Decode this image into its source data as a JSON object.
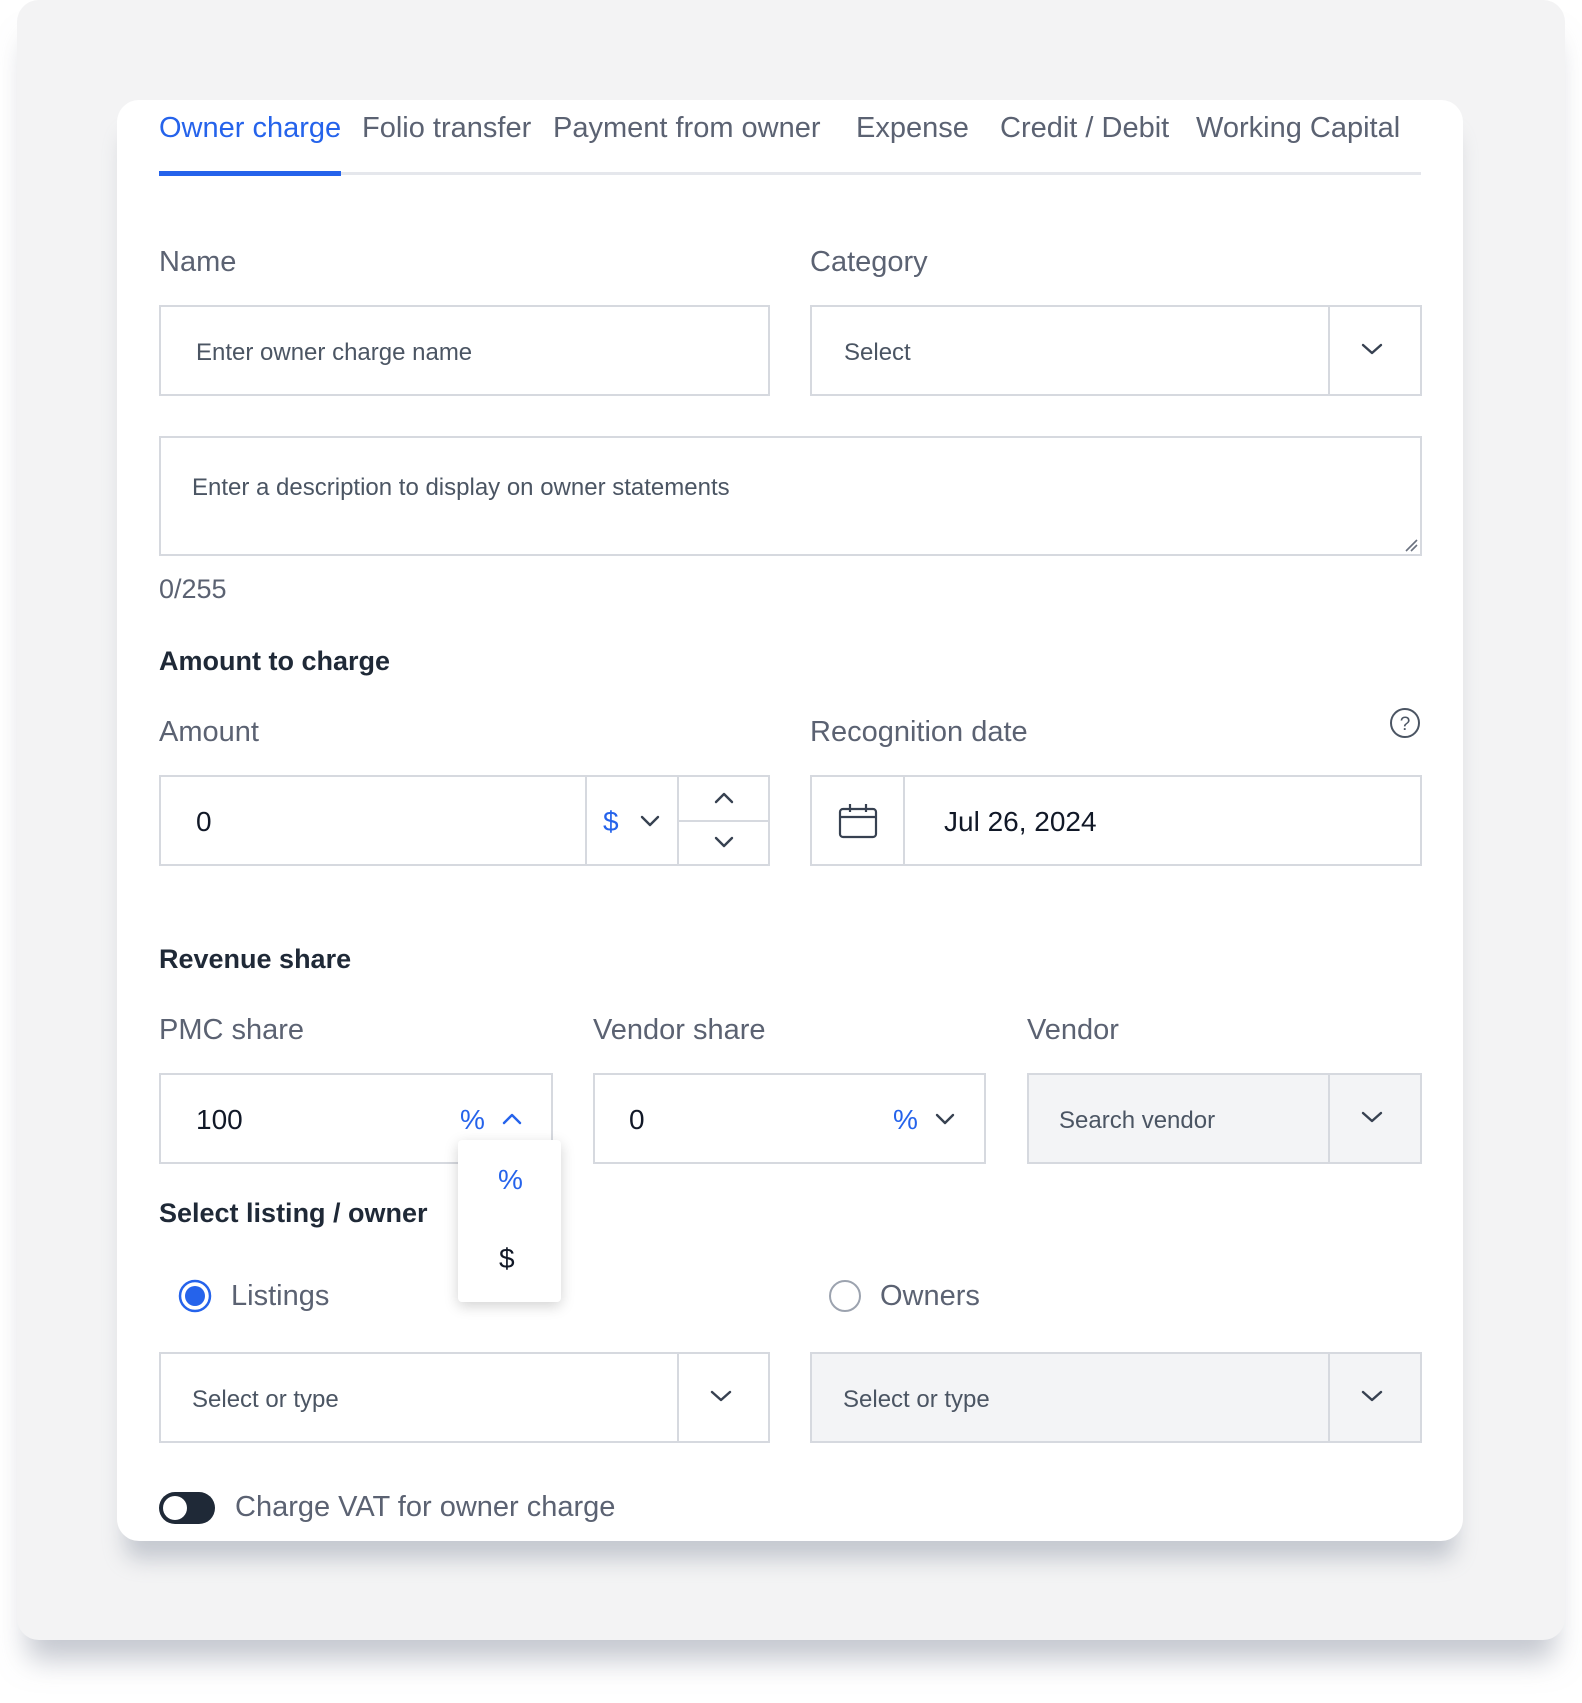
{
  "tabs": [
    {
      "label": "Owner charge",
      "active": true
    },
    {
      "label": "Folio transfer",
      "active": false
    },
    {
      "label": "Payment from owner",
      "active": false
    },
    {
      "label": "Expense",
      "active": false
    },
    {
      "label": "Credit / Debit",
      "active": false
    },
    {
      "label": "Working Capital",
      "active": false
    }
  ],
  "name": {
    "label": "Name",
    "placeholder": "Enter owner charge name"
  },
  "category": {
    "label": "Category",
    "placeholder": "Select"
  },
  "description": {
    "placeholder": "Enter a description to display on owner statements",
    "counter": "0/255"
  },
  "amount_section": {
    "title": "Amount to charge",
    "amount_label": "Amount",
    "amount_value": "0",
    "currency_symbol": "$",
    "recognition_label": "Recognition date",
    "recognition_date": "Jul 26, 2024"
  },
  "revenue_share": {
    "title": "Revenue share",
    "pmc_label": "PMC share",
    "pmc_value": "100",
    "pmc_unit": "%",
    "vendor_share_label": "Vendor share",
    "vendor_share_value": "0",
    "vendor_share_unit": "%",
    "vendor_label": "Vendor",
    "vendor_placeholder": "Search vendor"
  },
  "unit_dropdown": {
    "options": [
      "%",
      "$"
    ],
    "selected": "%"
  },
  "listing_owner": {
    "title": "Select listing / owner",
    "listings_label": "Listings",
    "listings_selected": true,
    "owners_label": "Owners",
    "owners_selected": false,
    "listings_placeholder": "Select or type",
    "owners_placeholder": "Select or type"
  },
  "vat": {
    "label": "Charge VAT for owner charge",
    "enabled": false
  },
  "colors": {
    "accent": "#2563eb",
    "toggle": "#1f2937",
    "border": "#d6d9df"
  }
}
